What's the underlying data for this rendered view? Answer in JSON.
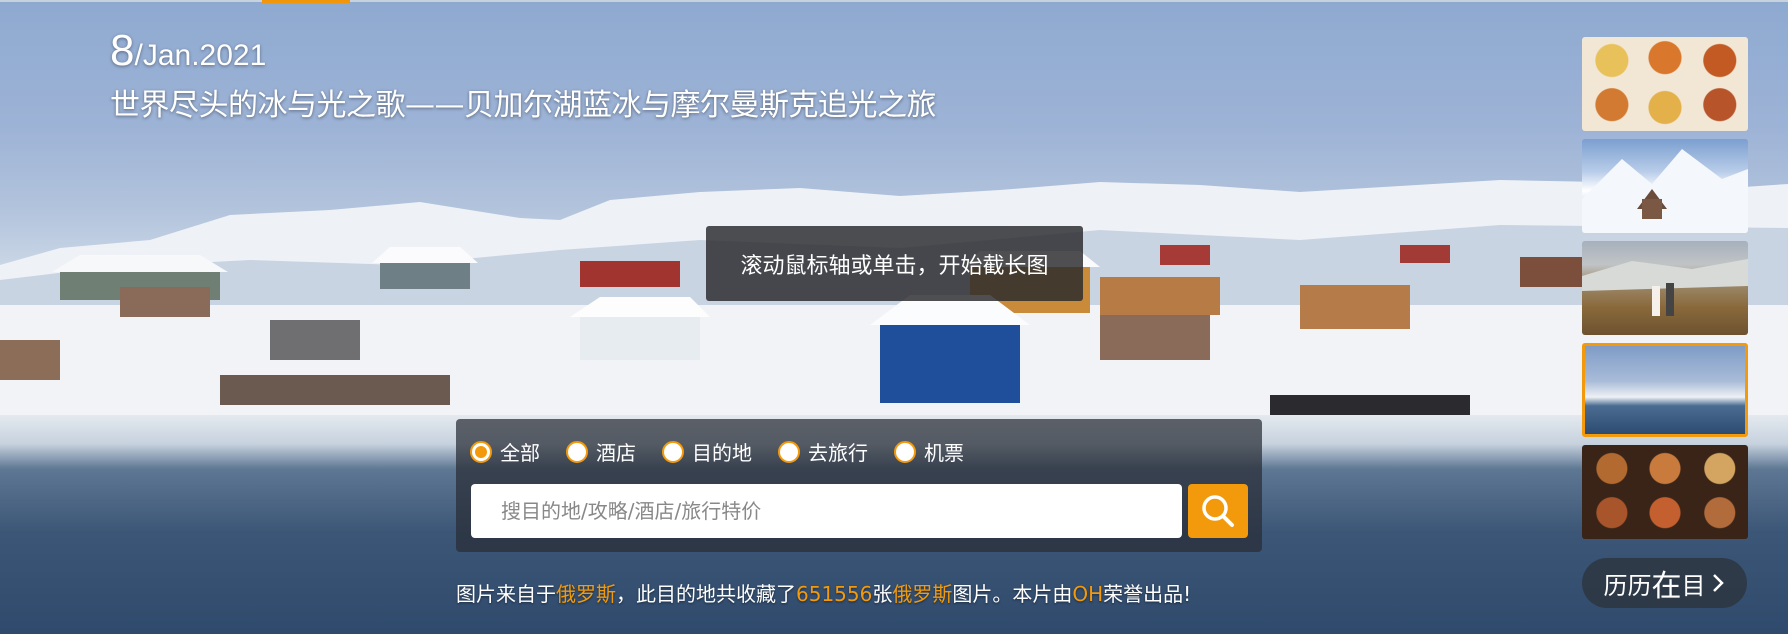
{
  "date": {
    "day": "8",
    "rest": "/Jan.2021"
  },
  "title": "世界尽头的冰与光之歌——贝加尔湖蓝冰与摩尔曼斯克追光之旅",
  "tooltip": "滚动鼠标轴或单击，开始截长图",
  "search": {
    "tabs": [
      {
        "label": "全部",
        "selected": true
      },
      {
        "label": "酒店",
        "selected": false
      },
      {
        "label": "目的地",
        "selected": false
      },
      {
        "label": "去旅行",
        "selected": false
      },
      {
        "label": "机票",
        "selected": false
      }
    ],
    "placeholder": "搜目的地/攻略/酒店/旅行特价",
    "button_icon": "search-icon"
  },
  "credit": {
    "p1": "图片来自于",
    "place1": "俄罗斯",
    "p2": "，此目的地共收藏了",
    "count": "651556",
    "p3": "张",
    "place2": "俄罗斯",
    "p4": "图片。本片由",
    "author": "OH",
    "p5": "荣誉出品!"
  },
  "thumbnails": [
    {
      "name": "food-dishes",
      "active": false
    },
    {
      "name": "snowy-mountain-monastery",
      "active": false
    },
    {
      "name": "couple-in-valley",
      "active": false
    },
    {
      "name": "snowy-harbor",
      "active": true
    },
    {
      "name": "stew-dishes",
      "active": false
    }
  ],
  "history_button": {
    "a": "历历",
    "b": "在",
    "c": "目",
    "icon": "chevron-right-icon"
  },
  "colors": {
    "accent": "#f29a0c",
    "tooltip_bg": "#28282c"
  }
}
